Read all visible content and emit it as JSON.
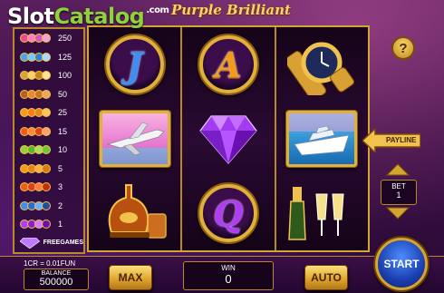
{
  "logo": {
    "slot": "Slot",
    "catalog": "Catalog",
    "com": ".com"
  },
  "title": "Purple Brilliant",
  "paytable": [
    {
      "value": "250",
      "colors": [
        "#e84b9a",
        "#ff7ec8",
        "#d95ab6",
        "#f2a2d9"
      ]
    },
    {
      "value": "125",
      "colors": [
        "#4aa6e8",
        "#7ac7ff",
        "#2e86cf",
        "#a6dcff"
      ]
    },
    {
      "value": "100",
      "colors": [
        "#d8a23a",
        "#f7d36b",
        "#c4861a",
        "#ffe39a"
      ]
    },
    {
      "value": "50",
      "colors": [
        "#b9601f",
        "#e38a3a",
        "#c4761a",
        "#f0a560"
      ]
    },
    {
      "value": "25",
      "colors": [
        "#f39a1c",
        "#ff7a1c",
        "#e3891c",
        "#ffc060"
      ]
    },
    {
      "value": "15",
      "colors": [
        "#f05a1c",
        "#ff8a3c",
        "#e0401c",
        "#ffa070"
      ]
    },
    {
      "value": "10",
      "colors": [
        "#8fd13a",
        "#5ab82e",
        "#a6e05a",
        "#6ac83a"
      ]
    },
    {
      "value": "5",
      "colors": [
        "#f39a1c",
        "#e3861c",
        "#ffb04a",
        "#d97a10"
      ]
    },
    {
      "value": "3",
      "colors": [
        "#f05a1c",
        "#e0401c",
        "#ff7a40",
        "#c4300c"
      ]
    },
    {
      "value": "2",
      "colors": [
        "#3f8df0",
        "#2e6bd1",
        "#6ab0ff",
        "#1d4fa0"
      ]
    },
    {
      "value": "1",
      "colors": [
        "#b13cf5",
        "#8a1fd1",
        "#d07aff",
        "#6a10b0"
      ]
    }
  ],
  "freegames_label": "FREEGAMES",
  "reels": [
    [
      {
        "type": "coin",
        "letter": "J",
        "color": "blue"
      },
      {
        "type": "card",
        "kind": "jet"
      },
      {
        "type": "bottle"
      }
    ],
    [
      {
        "type": "coin",
        "letter": "A",
        "color": "orange"
      },
      {
        "type": "gem"
      },
      {
        "type": "coin",
        "letter": "Q",
        "color": "purple"
      }
    ],
    [
      {
        "type": "watch"
      },
      {
        "type": "card",
        "kind": "yacht"
      },
      {
        "type": "champagne"
      }
    ]
  ],
  "help_label": "?",
  "payline_label": "PAYLINE",
  "bet": {
    "label": "BET",
    "value": "1"
  },
  "rate": "1CR = 0.01FUN",
  "balance": {
    "label": "BALANCE",
    "value": "500000"
  },
  "max_label": "MAX",
  "win": {
    "label": "WIN",
    "value": "0"
  },
  "auto_label": "AUTO",
  "start_label": "START"
}
